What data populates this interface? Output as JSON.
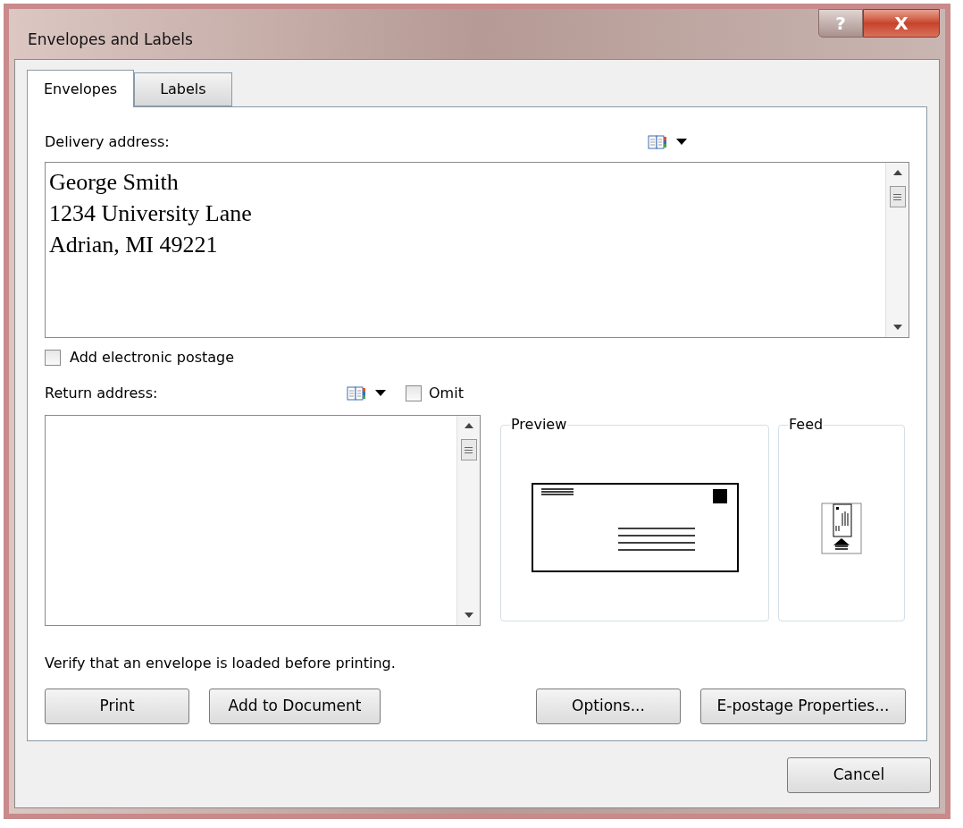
{
  "window": {
    "title": "Envelopes and Labels",
    "buttons": [
      "?",
      "X"
    ]
  },
  "tabs": [
    {
      "label": "Envelopes",
      "selected": true
    },
    {
      "label": "Labels",
      "selected": false
    }
  ],
  "delivery_address": {
    "label": "Delivery address:",
    "lines": [
      "George Smith",
      "1234 University Lane",
      "Adrian, MI 49221"
    ]
  },
  "electronic_postage": {
    "label": "Add electronic postage",
    "checked": false
  },
  "return_address": {
    "label": "Return address:",
    "omit": {
      "label": "Omit",
      "checked": false
    }
  },
  "preview": {
    "label": "Preview"
  },
  "feed": {
    "label": "Feed"
  },
  "note": "Verify that an envelope is loaded before printing.",
  "action_buttons": [
    "Print",
    "Add to Document",
    "Options...",
    "E-postage Properties..."
  ],
  "footer_buttons": [
    "Cancel"
  ]
}
